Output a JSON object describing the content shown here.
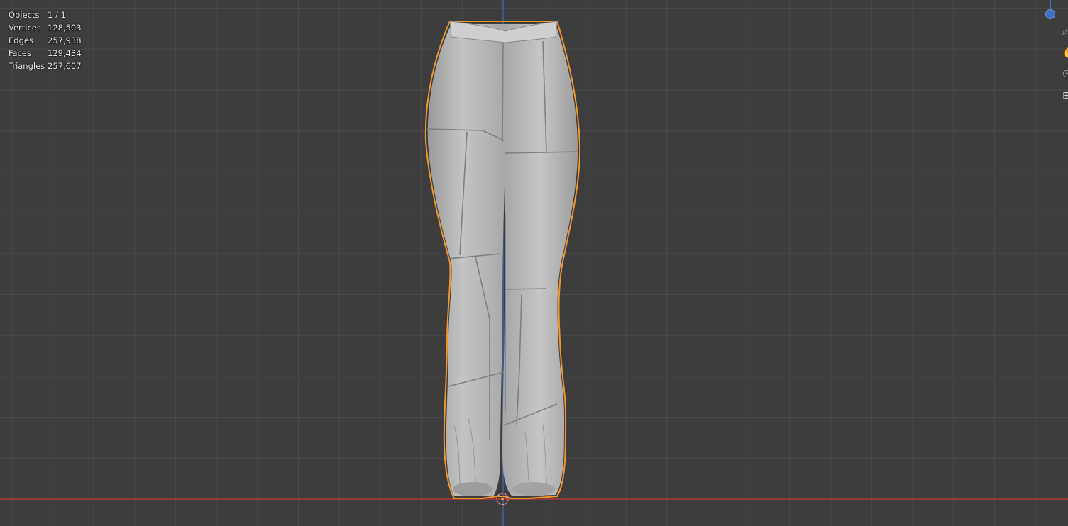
{
  "viewport": {
    "background_color": "#3d3d3d",
    "grid_color": "#4a4a4a",
    "axis_x_color": "#c0393b",
    "axis_z_color": "#3f6ec2",
    "selection_outline_color": "#f0952a",
    "mesh_color": "#bdbdbd"
  },
  "stats": {
    "objects": {
      "label": "Objects",
      "value": "1 / 1"
    },
    "vertices": {
      "label": "Vertices",
      "value": "128,503"
    },
    "edges": {
      "label": "Edges",
      "value": "257,938"
    },
    "faces": {
      "label": "Faces",
      "value": "129,434"
    },
    "triangles": {
      "label": "Triangles",
      "value": "257,607"
    }
  },
  "navigation": {
    "zoom_icon": "magnifier-icon",
    "pan_icon": "hand-icon",
    "camera_icon": "camera-icon",
    "perspective_icon": "grid-icon",
    "axis_gizmo": "z-axis"
  },
  "scene": {
    "object": "pants mesh",
    "origin_icon": "origin-crosshair-icon"
  }
}
